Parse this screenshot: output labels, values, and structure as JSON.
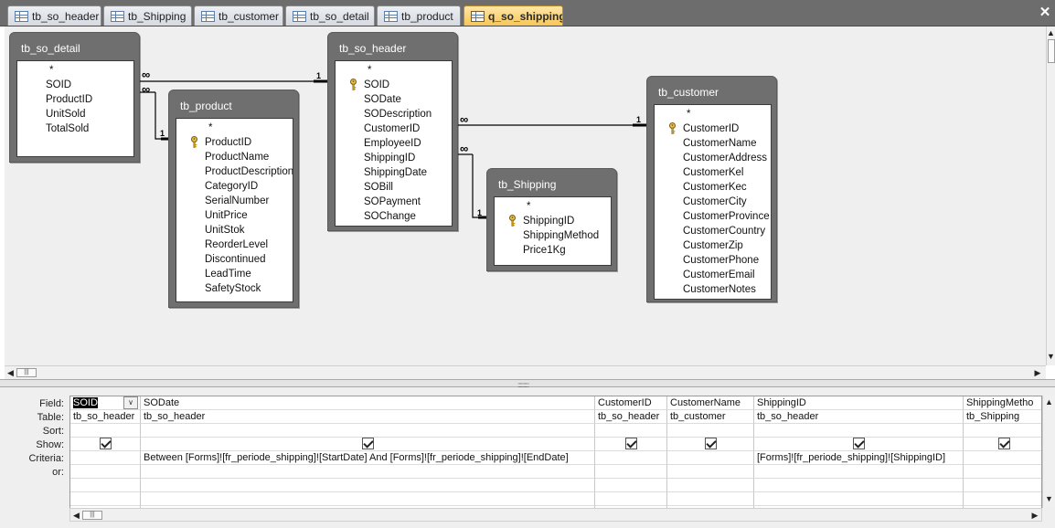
{
  "tabs": [
    {
      "label": "tb_so_header",
      "kind": "table",
      "active": false
    },
    {
      "label": "tb_Shipping",
      "kind": "table",
      "active": false
    },
    {
      "label": "tb_customer",
      "kind": "table",
      "active": false
    },
    {
      "label": "tb_so_detail",
      "kind": "table",
      "active": false
    },
    {
      "label": "tb_product",
      "kind": "table",
      "active": false
    },
    {
      "label": "q_so_shipping",
      "kind": "query",
      "active": true
    }
  ],
  "close_glyph": "✕",
  "tables": [
    {
      "name": "tb_so_detail",
      "fields": [
        {
          "name": "*",
          "key": false
        },
        {
          "name": "SOID",
          "key": false
        },
        {
          "name": "ProductID",
          "key": false
        },
        {
          "name": "UnitSold",
          "key": false
        },
        {
          "name": "TotalSold",
          "key": false
        }
      ]
    },
    {
      "name": "tb_product",
      "fields": [
        {
          "name": "*",
          "key": false
        },
        {
          "name": "ProductID",
          "key": true
        },
        {
          "name": "ProductName",
          "key": false
        },
        {
          "name": "ProductDescription",
          "key": false
        },
        {
          "name": "CategoryID",
          "key": false
        },
        {
          "name": "SerialNumber",
          "key": false
        },
        {
          "name": "UnitPrice",
          "key": false
        },
        {
          "name": "UnitStok",
          "key": false
        },
        {
          "name": "ReorderLevel",
          "key": false
        },
        {
          "name": "Discontinued",
          "key": false
        },
        {
          "name": "LeadTime",
          "key": false
        },
        {
          "name": "SafetyStock",
          "key": false
        }
      ]
    },
    {
      "name": "tb_so_header",
      "fields": [
        {
          "name": "*",
          "key": false
        },
        {
          "name": "SOID",
          "key": true
        },
        {
          "name": "SODate",
          "key": false
        },
        {
          "name": "SODescription",
          "key": false
        },
        {
          "name": "CustomerID",
          "key": false
        },
        {
          "name": "EmployeeID",
          "key": false
        },
        {
          "name": "ShippingID",
          "key": false
        },
        {
          "name": "ShippingDate",
          "key": false
        },
        {
          "name": "SOBill",
          "key": false
        },
        {
          "name": "SOPayment",
          "key": false
        },
        {
          "name": "SOChange",
          "key": false
        }
      ]
    },
    {
      "name": "tb_Shipping",
      "fields": [
        {
          "name": "*",
          "key": false
        },
        {
          "name": "ShippingID",
          "key": true
        },
        {
          "name": "ShippingMethod",
          "key": false
        },
        {
          "name": "Price1Kg",
          "key": false
        }
      ]
    },
    {
      "name": "tb_customer",
      "fields": [
        {
          "name": "*",
          "key": false
        },
        {
          "name": "CustomerID",
          "key": true
        },
        {
          "name": "CustomerName",
          "key": false
        },
        {
          "name": "CustomerAddress",
          "key": false
        },
        {
          "name": "CustomerKel",
          "key": false
        },
        {
          "name": "CustomerKec",
          "key": false
        },
        {
          "name": "CustomerCity",
          "key": false
        },
        {
          "name": "CustomerProvince",
          "key": false
        },
        {
          "name": "CustomerCountry",
          "key": false
        },
        {
          "name": "CustomerZip",
          "key": false
        },
        {
          "name": "CustomerPhone",
          "key": false
        },
        {
          "name": "CustomerEmail",
          "key": false
        },
        {
          "name": "CustomerNotes",
          "key": false
        }
      ]
    }
  ],
  "relationships": {
    "one": "1",
    "many": "∞"
  },
  "grid": {
    "row_labels": [
      "Field:",
      "Table:",
      "Sort:",
      "Show:",
      "Criteria:",
      "or:"
    ],
    "columns": [
      {
        "field": "SOID",
        "table": "tb_so_header",
        "sort": "",
        "show": true,
        "criteria": "",
        "or": "",
        "selected": true
      },
      {
        "field": "SODate",
        "table": "tb_so_header",
        "sort": "",
        "show": true,
        "criteria": "Between [Forms]![fr_periode_shipping]![StartDate] And [Forms]![fr_periode_shipping]![EndDate]",
        "or": "",
        "selected": false
      },
      {
        "field": "CustomerID",
        "table": "tb_so_header",
        "sort": "",
        "show": true,
        "criteria": "",
        "or": "",
        "selected": false
      },
      {
        "field": "CustomerName",
        "table": "tb_customer",
        "sort": "",
        "show": true,
        "criteria": "",
        "or": "",
        "selected": false
      },
      {
        "field": "ShippingID",
        "table": "tb_so_header",
        "sort": "",
        "show": true,
        "criteria": "[Forms]![fr_periode_shipping]![ShippingID]",
        "or": "",
        "selected": false
      },
      {
        "field": "ShippingMetho",
        "table": "tb_Shipping",
        "sort": "",
        "show": true,
        "criteria": "",
        "or": "",
        "selected": false
      }
    ]
  },
  "scroll": {
    "left": "◀",
    "right": "▶",
    "up": "▲",
    "down": "▼",
    "grip": "|||",
    "splitter_grip": "::::::::::"
  }
}
